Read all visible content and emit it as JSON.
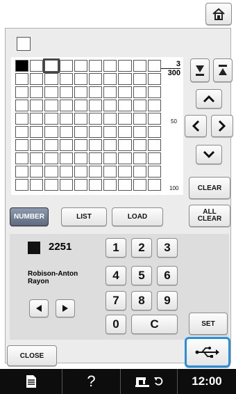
{
  "header": {
    "home_icon": "home-icon"
  },
  "palette": {
    "ratio_top": "3",
    "ratio_bottom": "300",
    "row_label_50": "50",
    "row_label_100": "100"
  },
  "buttons": {
    "clear": "CLEAR",
    "all_clear": "ALL CLEAR",
    "all_clear_l1": "ALL",
    "all_clear_l2": "CLEAR",
    "number": "NUMBER",
    "list": "LIST",
    "load": "LOAD",
    "set": "SET",
    "close": "CLOSE"
  },
  "thread": {
    "number": "2251",
    "brand_line1": "Robison-Anton",
    "brand_line2": "Rayon",
    "swatch_color": "#111111"
  },
  "keypad": [
    "1",
    "2",
    "3",
    "4",
    "5",
    "6",
    "7",
    "8",
    "9",
    "0",
    "C"
  ],
  "status_bar": {
    "time": "12:00",
    "help": "?"
  }
}
